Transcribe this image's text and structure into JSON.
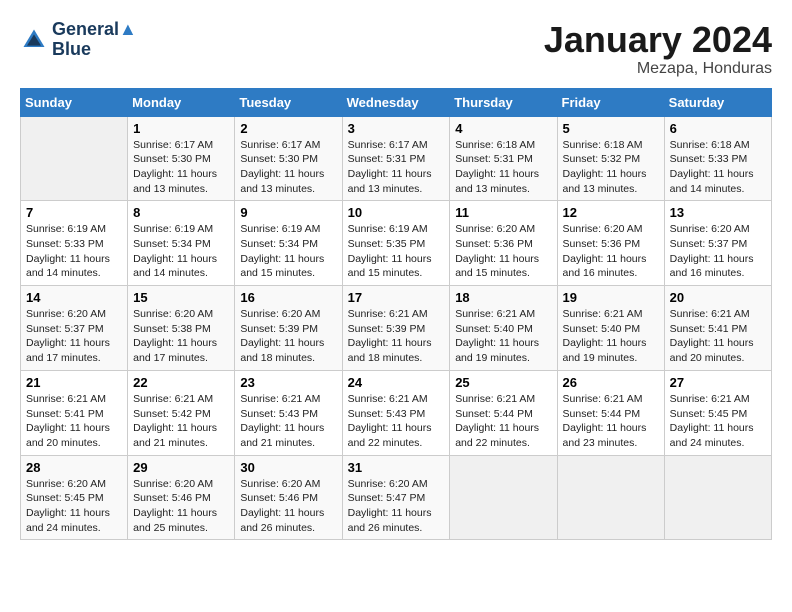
{
  "header": {
    "logo_line1": "General",
    "logo_line2": "Blue",
    "month": "January 2024",
    "location": "Mezapa, Honduras"
  },
  "days_of_week": [
    "Sunday",
    "Monday",
    "Tuesday",
    "Wednesday",
    "Thursday",
    "Friday",
    "Saturday"
  ],
  "weeks": [
    [
      {
        "day": "",
        "sunrise": "",
        "sunset": "",
        "daylight": ""
      },
      {
        "day": "1",
        "sunrise": "Sunrise: 6:17 AM",
        "sunset": "Sunset: 5:30 PM",
        "daylight": "Daylight: 11 hours and 13 minutes."
      },
      {
        "day": "2",
        "sunrise": "Sunrise: 6:17 AM",
        "sunset": "Sunset: 5:30 PM",
        "daylight": "Daylight: 11 hours and 13 minutes."
      },
      {
        "day": "3",
        "sunrise": "Sunrise: 6:17 AM",
        "sunset": "Sunset: 5:31 PM",
        "daylight": "Daylight: 11 hours and 13 minutes."
      },
      {
        "day": "4",
        "sunrise": "Sunrise: 6:18 AM",
        "sunset": "Sunset: 5:31 PM",
        "daylight": "Daylight: 11 hours and 13 minutes."
      },
      {
        "day": "5",
        "sunrise": "Sunrise: 6:18 AM",
        "sunset": "Sunset: 5:32 PM",
        "daylight": "Daylight: 11 hours and 13 minutes."
      },
      {
        "day": "6",
        "sunrise": "Sunrise: 6:18 AM",
        "sunset": "Sunset: 5:33 PM",
        "daylight": "Daylight: 11 hours and 14 minutes."
      }
    ],
    [
      {
        "day": "7",
        "sunrise": "Sunrise: 6:19 AM",
        "sunset": "Sunset: 5:33 PM",
        "daylight": "Daylight: 11 hours and 14 minutes."
      },
      {
        "day": "8",
        "sunrise": "Sunrise: 6:19 AM",
        "sunset": "Sunset: 5:34 PM",
        "daylight": "Daylight: 11 hours and 14 minutes."
      },
      {
        "day": "9",
        "sunrise": "Sunrise: 6:19 AM",
        "sunset": "Sunset: 5:34 PM",
        "daylight": "Daylight: 11 hours and 15 minutes."
      },
      {
        "day": "10",
        "sunrise": "Sunrise: 6:19 AM",
        "sunset": "Sunset: 5:35 PM",
        "daylight": "Daylight: 11 hours and 15 minutes."
      },
      {
        "day": "11",
        "sunrise": "Sunrise: 6:20 AM",
        "sunset": "Sunset: 5:36 PM",
        "daylight": "Daylight: 11 hours and 15 minutes."
      },
      {
        "day": "12",
        "sunrise": "Sunrise: 6:20 AM",
        "sunset": "Sunset: 5:36 PM",
        "daylight": "Daylight: 11 hours and 16 minutes."
      },
      {
        "day": "13",
        "sunrise": "Sunrise: 6:20 AM",
        "sunset": "Sunset: 5:37 PM",
        "daylight": "Daylight: 11 hours and 16 minutes."
      }
    ],
    [
      {
        "day": "14",
        "sunrise": "Sunrise: 6:20 AM",
        "sunset": "Sunset: 5:37 PM",
        "daylight": "Daylight: 11 hours and 17 minutes."
      },
      {
        "day": "15",
        "sunrise": "Sunrise: 6:20 AM",
        "sunset": "Sunset: 5:38 PM",
        "daylight": "Daylight: 11 hours and 17 minutes."
      },
      {
        "day": "16",
        "sunrise": "Sunrise: 6:20 AM",
        "sunset": "Sunset: 5:39 PM",
        "daylight": "Daylight: 11 hours and 18 minutes."
      },
      {
        "day": "17",
        "sunrise": "Sunrise: 6:21 AM",
        "sunset": "Sunset: 5:39 PM",
        "daylight": "Daylight: 11 hours and 18 minutes."
      },
      {
        "day": "18",
        "sunrise": "Sunrise: 6:21 AM",
        "sunset": "Sunset: 5:40 PM",
        "daylight": "Daylight: 11 hours and 19 minutes."
      },
      {
        "day": "19",
        "sunrise": "Sunrise: 6:21 AM",
        "sunset": "Sunset: 5:40 PM",
        "daylight": "Daylight: 11 hours and 19 minutes."
      },
      {
        "day": "20",
        "sunrise": "Sunrise: 6:21 AM",
        "sunset": "Sunset: 5:41 PM",
        "daylight": "Daylight: 11 hours and 20 minutes."
      }
    ],
    [
      {
        "day": "21",
        "sunrise": "Sunrise: 6:21 AM",
        "sunset": "Sunset: 5:41 PM",
        "daylight": "Daylight: 11 hours and 20 minutes."
      },
      {
        "day": "22",
        "sunrise": "Sunrise: 6:21 AM",
        "sunset": "Sunset: 5:42 PM",
        "daylight": "Daylight: 11 hours and 21 minutes."
      },
      {
        "day": "23",
        "sunrise": "Sunrise: 6:21 AM",
        "sunset": "Sunset: 5:43 PM",
        "daylight": "Daylight: 11 hours and 21 minutes."
      },
      {
        "day": "24",
        "sunrise": "Sunrise: 6:21 AM",
        "sunset": "Sunset: 5:43 PM",
        "daylight": "Daylight: 11 hours and 22 minutes."
      },
      {
        "day": "25",
        "sunrise": "Sunrise: 6:21 AM",
        "sunset": "Sunset: 5:44 PM",
        "daylight": "Daylight: 11 hours and 22 minutes."
      },
      {
        "day": "26",
        "sunrise": "Sunrise: 6:21 AM",
        "sunset": "Sunset: 5:44 PM",
        "daylight": "Daylight: 11 hours and 23 minutes."
      },
      {
        "day": "27",
        "sunrise": "Sunrise: 6:21 AM",
        "sunset": "Sunset: 5:45 PM",
        "daylight": "Daylight: 11 hours and 24 minutes."
      }
    ],
    [
      {
        "day": "28",
        "sunrise": "Sunrise: 6:20 AM",
        "sunset": "Sunset: 5:45 PM",
        "daylight": "Daylight: 11 hours and 24 minutes."
      },
      {
        "day": "29",
        "sunrise": "Sunrise: 6:20 AM",
        "sunset": "Sunset: 5:46 PM",
        "daylight": "Daylight: 11 hours and 25 minutes."
      },
      {
        "day": "30",
        "sunrise": "Sunrise: 6:20 AM",
        "sunset": "Sunset: 5:46 PM",
        "daylight": "Daylight: 11 hours and 26 minutes."
      },
      {
        "day": "31",
        "sunrise": "Sunrise: 6:20 AM",
        "sunset": "Sunset: 5:47 PM",
        "daylight": "Daylight: 11 hours and 26 minutes."
      },
      {
        "day": "",
        "sunrise": "",
        "sunset": "",
        "daylight": ""
      },
      {
        "day": "",
        "sunrise": "",
        "sunset": "",
        "daylight": ""
      },
      {
        "day": "",
        "sunrise": "",
        "sunset": "",
        "daylight": ""
      }
    ]
  ]
}
